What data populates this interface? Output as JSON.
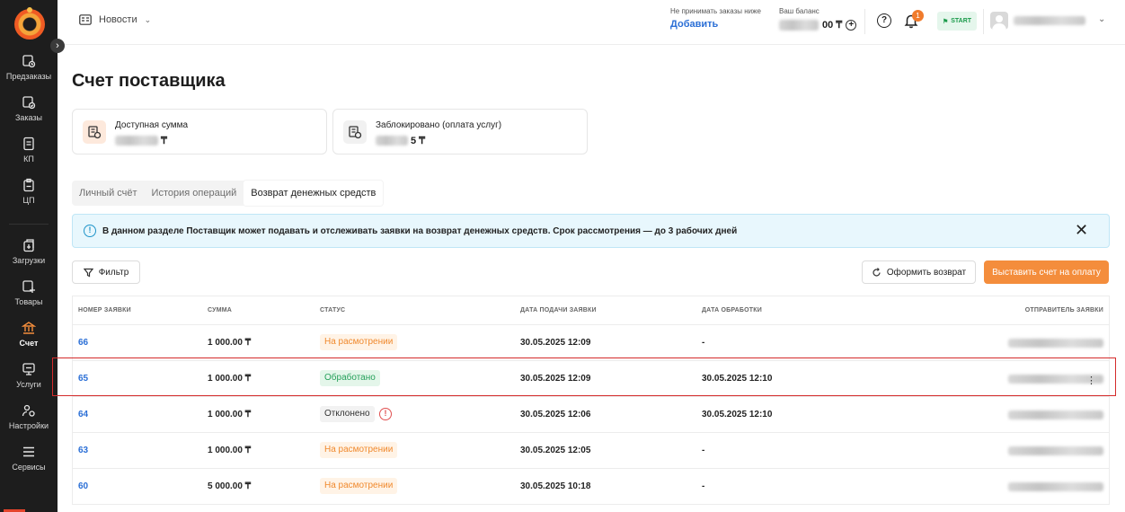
{
  "sidebar": {
    "items": [
      {
        "label": "Предзаказы",
        "icon": "preorder-icon"
      },
      {
        "label": "Заказы",
        "icon": "orders-icon"
      },
      {
        "label": "КП",
        "icon": "document-icon"
      },
      {
        "label": "ЦП",
        "icon": "price-icon"
      },
      {
        "label": "Загрузки",
        "icon": "upload-icon"
      },
      {
        "label": "Товары",
        "icon": "products-icon"
      },
      {
        "label": "Счет",
        "icon": "bank-icon"
      },
      {
        "label": "Услуги",
        "icon": "services-icon"
      },
      {
        "label": "Настройки",
        "icon": "settings-icon"
      },
      {
        "label": "Сервисы",
        "icon": "menu-icon"
      }
    ]
  },
  "header": {
    "news_label": "Новости",
    "limit_caption": "Не принимать заказы ниже",
    "limit_link": "Добавить",
    "balance_caption": "Ваш баланс",
    "balance_suffix": "00 ₸",
    "start_label": "START",
    "notification_count": "1"
  },
  "main": {
    "title": "Счет поставщика",
    "cards": [
      {
        "title": "Доступная сумма",
        "suffix": "₸"
      },
      {
        "title": "Заблокировано (оплата услуг)",
        "suffix": "5 ₸"
      }
    ],
    "tabs": [
      {
        "label": "Личный счёт"
      },
      {
        "label": "История операций"
      },
      {
        "label": "Возврат денежных средств"
      }
    ],
    "info_text": "В данном разделе Поставщик может подавать и отслеживать заявки на возврат денежных средств. Срок рассмотрения — до 3 рабочих дней",
    "filter_label": "Фильтр",
    "return_label": "Оформить возврат",
    "invoice_label": "Выставить счет на оплату"
  },
  "table": {
    "columns": [
      "НОМЕР ЗАЯВКИ",
      "СУММА",
      "СТАТУС",
      "ДАТА ПОДАЧИ ЗАЯВКИ",
      "ДАТА ОБРАБОТКИ",
      "ОТПРАВИТЕЛЬ ЗАЯВКИ"
    ],
    "rows": [
      {
        "id": "66",
        "sum": "1 000.00 ₸",
        "status": "На расмотрении",
        "status_type": "review",
        "submitted": "30.05.2025 12:09",
        "processed": "-"
      },
      {
        "id": "65",
        "sum": "1 000.00 ₸",
        "status": "Обработано",
        "status_type": "done",
        "submitted": "30.05.2025 12:09",
        "processed": "30.05.2025 12:10"
      },
      {
        "id": "64",
        "sum": "1 000.00 ₸",
        "status": "Отклонено",
        "status_type": "rejected",
        "submitted": "30.05.2025 12:06",
        "processed": "30.05.2025 12:10"
      },
      {
        "id": "63",
        "sum": "1 000.00 ₸",
        "status": "На расмотрении",
        "status_type": "review",
        "submitted": "30.05.2025 12:05",
        "processed": "-"
      },
      {
        "id": "60",
        "sum": "5 000.00 ₸",
        "status": "На расмотрении",
        "status_type": "review",
        "submitted": "30.05.2025 10:18",
        "processed": "-"
      }
    ]
  },
  "colors": {
    "sidebar_bg": "#1d1d1d",
    "accent": "#f48d3c",
    "link": "#2b6fd6",
    "highlight": "#d42b2b"
  }
}
